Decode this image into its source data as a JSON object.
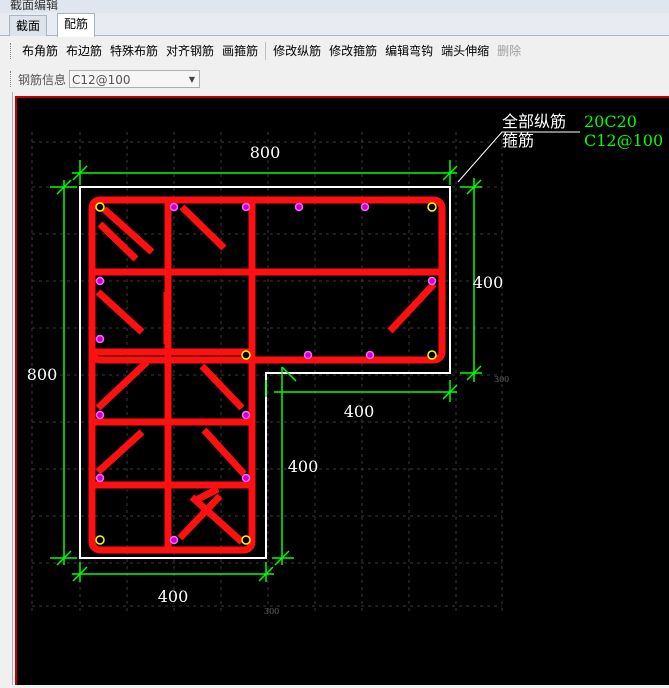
{
  "window": {
    "title": "截面编辑"
  },
  "tabs": [
    {
      "label": "截面",
      "active": false
    },
    {
      "label": "配筋",
      "active": true
    }
  ],
  "toolbar": {
    "buttons": [
      {
        "label": "布角筋",
        "enabled": true
      },
      {
        "label": "布边筋",
        "enabled": true
      },
      {
        "label": "特殊布筋",
        "enabled": true
      },
      {
        "label": "对齐钢筋",
        "enabled": true
      },
      {
        "label": "画箍筋",
        "enabled": true
      },
      {
        "label": "修改纵筋",
        "enabled": true
      },
      {
        "label": "修改箍筋",
        "enabled": true
      },
      {
        "label": "编辑弯钩",
        "enabled": true
      },
      {
        "label": "端头伸缩",
        "enabled": true
      },
      {
        "label": "删除",
        "enabled": false
      }
    ]
  },
  "rebar_info": {
    "label": "钢筋信息",
    "value": "C12@100"
  },
  "canvas": {
    "legend": {
      "longitudinal_label": "全部纵筋",
      "longitudinal_value": "20C20",
      "stirrup_label": "箍筋",
      "stirrup_value": "C12@100"
    },
    "dimensions": {
      "top_width": "800",
      "right_height": "400",
      "notch_width": "400",
      "left_height": "800",
      "lower_right_height": "400",
      "bottom_width": "400",
      "small_right": "300",
      "small_bottom": "300"
    },
    "colors": {
      "background": "#000000",
      "dimension": "#00ff00",
      "outline": "#ffffff",
      "stirrup": "#ff0000",
      "bar_fill": "#cc00cc",
      "corner_bar": "#ffff00"
    }
  }
}
